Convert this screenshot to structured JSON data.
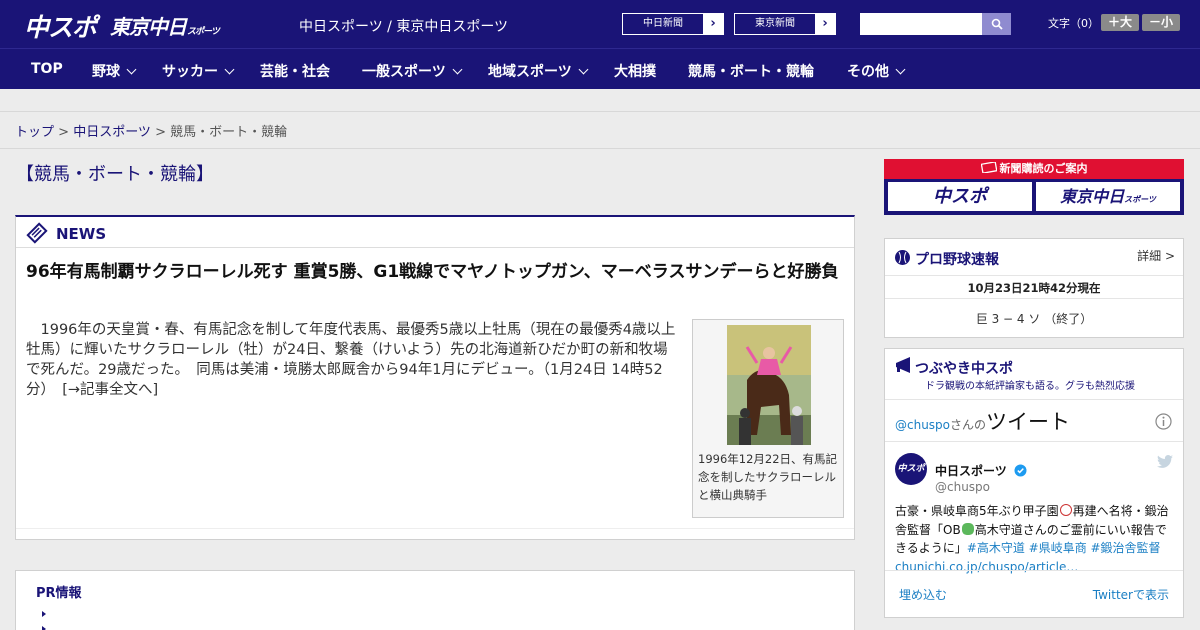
{
  "header": {
    "logo_chuspo": "中スポ",
    "logo_tokyo": "東京中日",
    "logo_tokyo_sub": "スポーツ",
    "tagline": "中日スポーツ / 東京中日スポーツ",
    "site_links": [
      "中日新聞",
      "東京新聞"
    ],
    "font_size_label": "文字（0）",
    "font_bigger": "＋大",
    "font_smaller": "－小"
  },
  "nav": {
    "items": [
      {
        "label": "TOP"
      },
      {
        "label": "野球"
      },
      {
        "label": "サッカー"
      },
      {
        "label": "芸能・社会"
      },
      {
        "label": "一般スポーツ"
      },
      {
        "label": "地域スポーツ"
      },
      {
        "label": "大相撲"
      },
      {
        "label": "競馬・ボート・競輪"
      },
      {
        "label": "その他"
      }
    ]
  },
  "breadcrumb": {
    "home": "トップ",
    "sep": " > ",
    "parent": "中日スポーツ",
    "current": "競馬・ボート・競輪"
  },
  "main": {
    "page_title": "【競馬・ボート・競輪】",
    "section_label": "NEWS",
    "article": {
      "title": "96年有馬制覇サクラローレル死す 重賞5勝、G1戦線でマヤノトップガン、マーベラスサンデーらと好勝負",
      "body": "1996年の天皇賞・春、有馬記念を制して年度代表馬、最優秀5歳以上牡馬（現在の最優秀4歳以上牡馬）に輝いたサクラローレル（牡）が24日、繋養（けいよう）先の北海道新ひだか町の新和牧場で死んだ。29歳だった。　同馬は美浦・境勝太郎厩舎から94年1月にデビュー。（1月24日 14時52分）　[→記事全文へ]",
      "photo_caption": "1996年12月22日、有馬記念を制したサクラローレルと横山典騎手"
    },
    "pr_title": "PR情報"
  },
  "sidebar": {
    "subscribe_title": "新聞購読のご案内",
    "subscribe_btn1": "中スポ",
    "subscribe_btn2": "東京中日",
    "subscribe_btn2_sub": "スポーツ",
    "baseball": {
      "title": "プロ野球速報",
      "more": "詳細 >",
      "timestamp": "10月23日21時42分現在",
      "score": "巨 3 − 4 ソ （終了）"
    },
    "twitter": {
      "title": "つぶやき中スポ",
      "subtitle": "ドラ観戦の本紙評論家も語る。グラも熱烈応援",
      "handle_prefix": "@chuspo",
      "handle_suffix": "さんの",
      "tweets_label": "ツイート",
      "user_name": "中日スポーツ",
      "user_handle": "@chuspo",
      "avatar_text": "中スポ",
      "tweet_text_1": "古豪・県岐阜商5年ぶり甲子園",
      "tweet_text_2": "再建へ名将・鍛治舎監督「OB",
      "tweet_text_3": "高木守道さんのご霊前にいい報告できるように」",
      "tweet_tags": "#高木守道 #県岐阜商 #鍛治舎監督",
      "tweet_link": "chunichi.co.jp/chuspo/article…",
      "embed": "埋め込む",
      "view_on": "Twitterで表示"
    }
  }
}
